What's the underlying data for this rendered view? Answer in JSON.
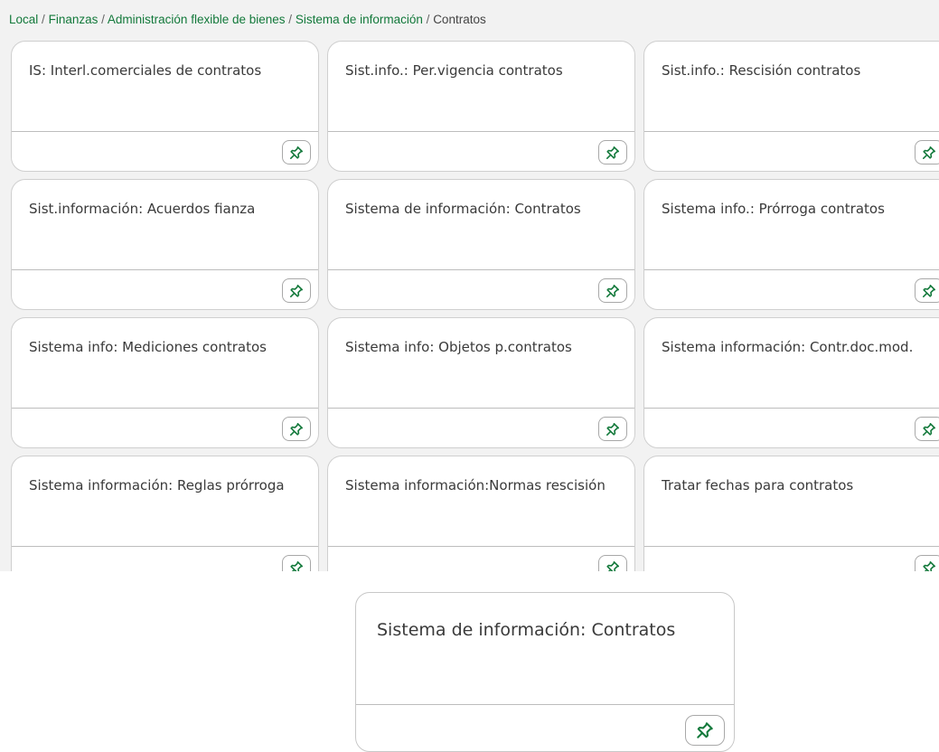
{
  "breadcrumb": {
    "items": [
      {
        "label": "Local"
      },
      {
        "label": "Finanzas"
      },
      {
        "label": "Administración flexible de bienes"
      },
      {
        "label": "Sistema de información"
      }
    ],
    "separator": "/",
    "current": "Contratos"
  },
  "tiles": [
    {
      "title": "IS: Interl.comerciales de contratos",
      "pin_icon": "pin-icon"
    },
    {
      "title": "Sist.info.: Per.vigencia contratos",
      "pin_icon": "pin-icon"
    },
    {
      "title": "Sist.info.: Rescisión contratos",
      "pin_icon": "pin-icon"
    },
    {
      "title": "Sist.información: Acuerdos fianza",
      "pin_icon": "pin-icon"
    },
    {
      "title": "Sistema de información: Contratos",
      "pin_icon": "pin-icon"
    },
    {
      "title": "Sistema info.: Prórroga contratos",
      "pin_icon": "pin-icon"
    },
    {
      "title": "Sistema info: Mediciones contratos",
      "pin_icon": "pin-icon"
    },
    {
      "title": "Sistema info: Objetos p.contratos",
      "pin_icon": "pin-icon"
    },
    {
      "title": "Sistema información: Contr.doc.mod.",
      "pin_icon": "pin-icon"
    },
    {
      "title": "Sistema información: Reglas prórroga",
      "pin_icon": "pin-icon"
    },
    {
      "title": "Sistema información:Normas rescisión",
      "pin_icon": "pin-icon"
    },
    {
      "title": "Tratar fechas para contratos",
      "pin_icon": "pin-icon"
    }
  ],
  "preview_tile": {
    "title": "Sistema de información: Contratos",
    "pin_icon": "pin-icon"
  },
  "colors": {
    "link": "#13793b",
    "pin_green": "#13793b",
    "tile_border": "#cfcfcf",
    "background": "#f2f2f2"
  }
}
